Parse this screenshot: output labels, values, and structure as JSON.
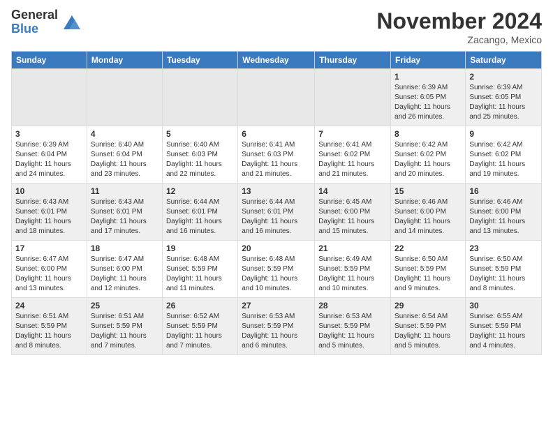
{
  "logo": {
    "general": "General",
    "blue": "Blue"
  },
  "header": {
    "month": "November 2024",
    "location": "Zacango, Mexico"
  },
  "weekdays": [
    "Sunday",
    "Monday",
    "Tuesday",
    "Wednesday",
    "Thursday",
    "Friday",
    "Saturday"
  ],
  "weeks": [
    [
      {
        "day": "",
        "info": ""
      },
      {
        "day": "",
        "info": ""
      },
      {
        "day": "",
        "info": ""
      },
      {
        "day": "",
        "info": ""
      },
      {
        "day": "",
        "info": ""
      },
      {
        "day": "1",
        "info": "Sunrise: 6:39 AM\nSunset: 6:05 PM\nDaylight: 11 hours and 26 minutes."
      },
      {
        "day": "2",
        "info": "Sunrise: 6:39 AM\nSunset: 6:05 PM\nDaylight: 11 hours and 25 minutes."
      }
    ],
    [
      {
        "day": "3",
        "info": "Sunrise: 6:39 AM\nSunset: 6:04 PM\nDaylight: 11 hours and 24 minutes."
      },
      {
        "day": "4",
        "info": "Sunrise: 6:40 AM\nSunset: 6:04 PM\nDaylight: 11 hours and 23 minutes."
      },
      {
        "day": "5",
        "info": "Sunrise: 6:40 AM\nSunset: 6:03 PM\nDaylight: 11 hours and 22 minutes."
      },
      {
        "day": "6",
        "info": "Sunrise: 6:41 AM\nSunset: 6:03 PM\nDaylight: 11 hours and 21 minutes."
      },
      {
        "day": "7",
        "info": "Sunrise: 6:41 AM\nSunset: 6:02 PM\nDaylight: 11 hours and 21 minutes."
      },
      {
        "day": "8",
        "info": "Sunrise: 6:42 AM\nSunset: 6:02 PM\nDaylight: 11 hours and 20 minutes."
      },
      {
        "day": "9",
        "info": "Sunrise: 6:42 AM\nSunset: 6:02 PM\nDaylight: 11 hours and 19 minutes."
      }
    ],
    [
      {
        "day": "10",
        "info": "Sunrise: 6:43 AM\nSunset: 6:01 PM\nDaylight: 11 hours and 18 minutes."
      },
      {
        "day": "11",
        "info": "Sunrise: 6:43 AM\nSunset: 6:01 PM\nDaylight: 11 hours and 17 minutes."
      },
      {
        "day": "12",
        "info": "Sunrise: 6:44 AM\nSunset: 6:01 PM\nDaylight: 11 hours and 16 minutes."
      },
      {
        "day": "13",
        "info": "Sunrise: 6:44 AM\nSunset: 6:01 PM\nDaylight: 11 hours and 16 minutes."
      },
      {
        "day": "14",
        "info": "Sunrise: 6:45 AM\nSunset: 6:00 PM\nDaylight: 11 hours and 15 minutes."
      },
      {
        "day": "15",
        "info": "Sunrise: 6:46 AM\nSunset: 6:00 PM\nDaylight: 11 hours and 14 minutes."
      },
      {
        "day": "16",
        "info": "Sunrise: 6:46 AM\nSunset: 6:00 PM\nDaylight: 11 hours and 13 minutes."
      }
    ],
    [
      {
        "day": "17",
        "info": "Sunrise: 6:47 AM\nSunset: 6:00 PM\nDaylight: 11 hours and 13 minutes."
      },
      {
        "day": "18",
        "info": "Sunrise: 6:47 AM\nSunset: 6:00 PM\nDaylight: 11 hours and 12 minutes."
      },
      {
        "day": "19",
        "info": "Sunrise: 6:48 AM\nSunset: 5:59 PM\nDaylight: 11 hours and 11 minutes."
      },
      {
        "day": "20",
        "info": "Sunrise: 6:48 AM\nSunset: 5:59 PM\nDaylight: 11 hours and 10 minutes."
      },
      {
        "day": "21",
        "info": "Sunrise: 6:49 AM\nSunset: 5:59 PM\nDaylight: 11 hours and 10 minutes."
      },
      {
        "day": "22",
        "info": "Sunrise: 6:50 AM\nSunset: 5:59 PM\nDaylight: 11 hours and 9 minutes."
      },
      {
        "day": "23",
        "info": "Sunrise: 6:50 AM\nSunset: 5:59 PM\nDaylight: 11 hours and 8 minutes."
      }
    ],
    [
      {
        "day": "24",
        "info": "Sunrise: 6:51 AM\nSunset: 5:59 PM\nDaylight: 11 hours and 8 minutes."
      },
      {
        "day": "25",
        "info": "Sunrise: 6:51 AM\nSunset: 5:59 PM\nDaylight: 11 hours and 7 minutes."
      },
      {
        "day": "26",
        "info": "Sunrise: 6:52 AM\nSunset: 5:59 PM\nDaylight: 11 hours and 7 minutes."
      },
      {
        "day": "27",
        "info": "Sunrise: 6:53 AM\nSunset: 5:59 PM\nDaylight: 11 hours and 6 minutes."
      },
      {
        "day": "28",
        "info": "Sunrise: 6:53 AM\nSunset: 5:59 PM\nDaylight: 11 hours and 5 minutes."
      },
      {
        "day": "29",
        "info": "Sunrise: 6:54 AM\nSunset: 5:59 PM\nDaylight: 11 hours and 5 minutes."
      },
      {
        "day": "30",
        "info": "Sunrise: 6:55 AM\nSunset: 5:59 PM\nDaylight: 11 hours and 4 minutes."
      }
    ]
  ]
}
